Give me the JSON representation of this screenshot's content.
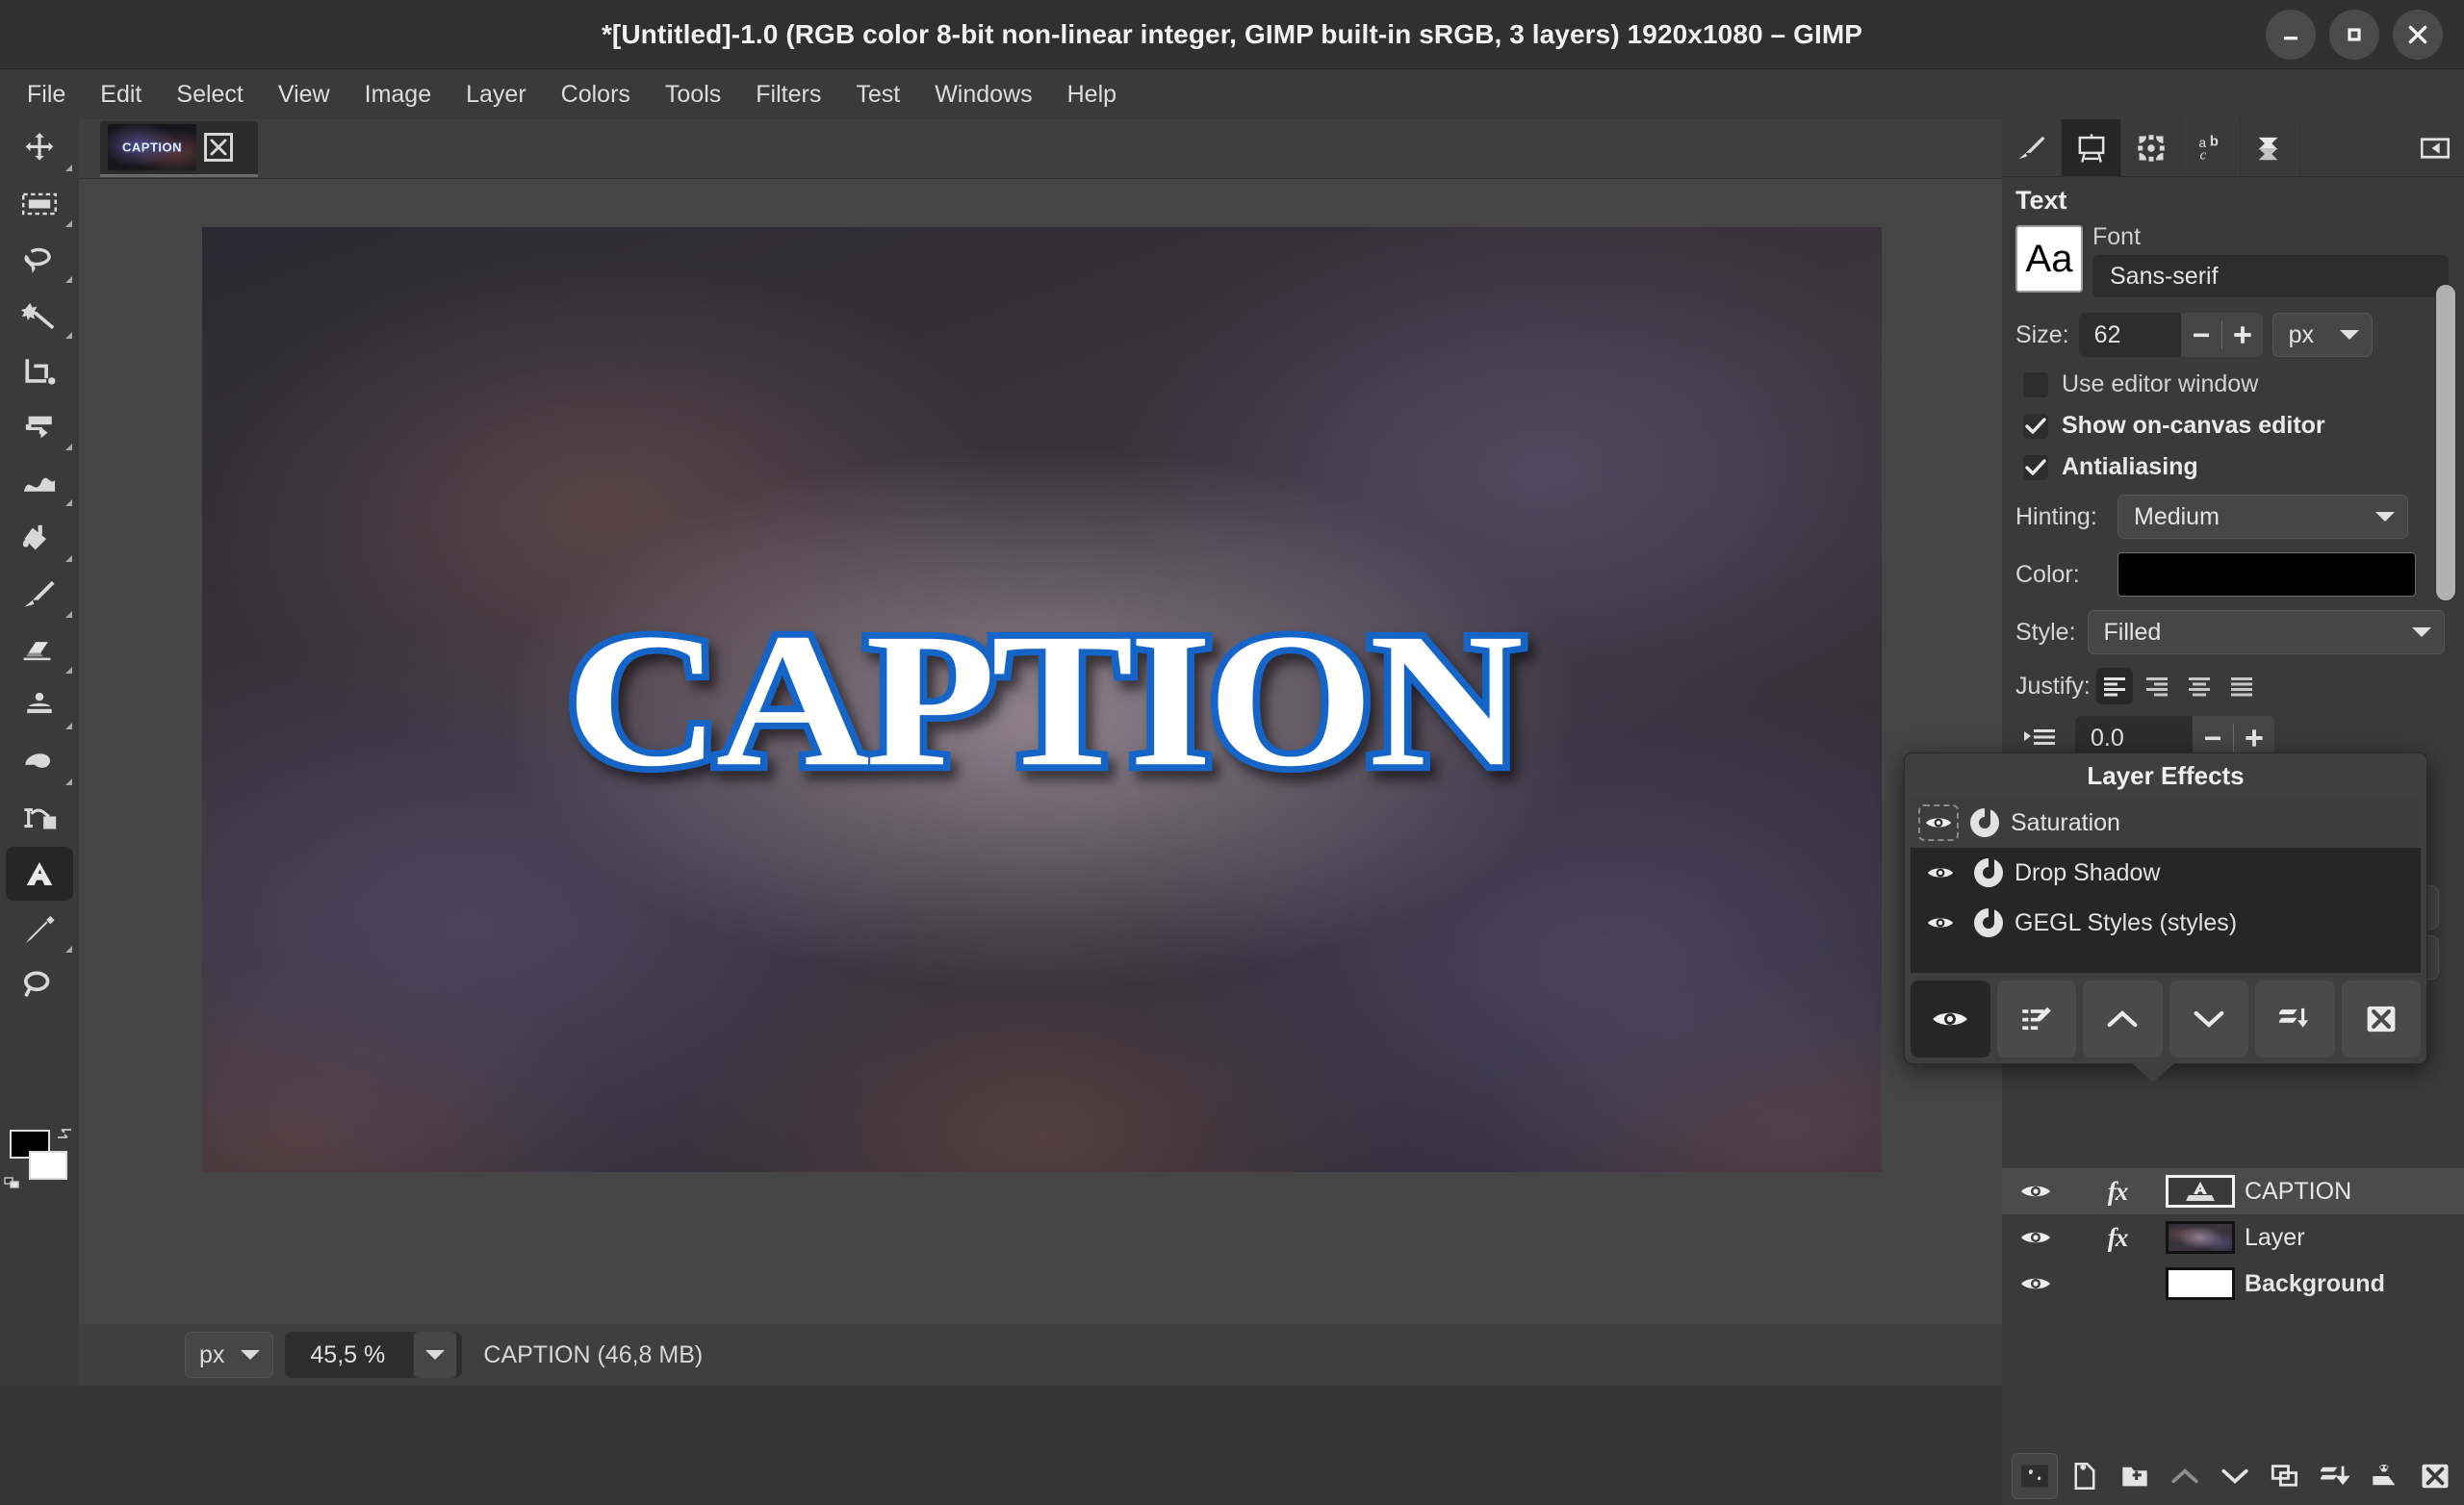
{
  "window": {
    "title": "*[Untitled]-1.0 (RGB color 8-bit non-linear integer, GIMP built-in sRGB, 3 layers) 1920x1080 – GIMP",
    "minimize_label": "minimize",
    "maximize_label": "maximize",
    "close_label": "close"
  },
  "menubar": {
    "items": [
      "File",
      "Edit",
      "Select",
      "View",
      "Image",
      "Layer",
      "Colors",
      "Tools",
      "Filters",
      "Test",
      "Windows",
      "Help"
    ]
  },
  "toolbox": {
    "tools": [
      {
        "name": "move-tool",
        "icon": "move-icon"
      },
      {
        "name": "rectangle-select-tool",
        "icon": "rectangle-select-icon"
      },
      {
        "name": "free-select-tool",
        "icon": "lasso-icon"
      },
      {
        "name": "fuzzy-select-tool",
        "icon": "magic-wand-icon"
      },
      {
        "name": "crop-tool",
        "icon": "crop-icon"
      },
      {
        "name": "transform-tool",
        "icon": "transform-icon"
      },
      {
        "name": "warp-transform-tool",
        "icon": "warp-icon"
      },
      {
        "name": "bucket-fill-tool",
        "icon": "bucket-fill-icon"
      },
      {
        "name": "paintbrush-tool",
        "icon": "paintbrush-icon"
      },
      {
        "name": "eraser-tool",
        "icon": "eraser-icon"
      },
      {
        "name": "clone-tool",
        "icon": "clone-stamp-icon"
      },
      {
        "name": "smudge-tool",
        "icon": "smudge-icon"
      },
      {
        "name": "paths-tool",
        "icon": "paths-icon"
      },
      {
        "name": "text-tool",
        "icon": "text-a-icon"
      },
      {
        "name": "color-picker-tool",
        "icon": "eyedropper-icon"
      },
      {
        "name": "zoom-tool",
        "icon": "magnifier-icon"
      }
    ],
    "active_tool": "text-tool",
    "foreground_color": "#000000",
    "background_color": "#ffffff"
  },
  "tab": {
    "thumbnail_label": "CAPTION",
    "close_label": "close-image"
  },
  "canvas": {
    "caption_text": "CAPTION",
    "text_fill_color": "#ffffff",
    "text_stroke_color": "#1565c8"
  },
  "statusbar": {
    "unit": "px",
    "zoom": "45,5 %",
    "status": "CAPTION (46,8 MB)"
  },
  "dock": {
    "tabs": [
      {
        "name": "tab-brushes",
        "icon": "paintbrush-icon"
      },
      {
        "name": "tab-tool-options",
        "icon": "tool-options-easel-icon"
      },
      {
        "name": "tab-patterns",
        "icon": "patterns-icon"
      },
      {
        "name": "tab-fonts",
        "icon": "fonts-abc-icon"
      },
      {
        "name": "tab-document-history",
        "icon": "layers-stack-icon"
      }
    ],
    "active_tab": "tab-tool-options",
    "collapse_label": "collapse-dock"
  },
  "tool_options": {
    "section_title": "Text",
    "font_preview_glyphs": "Aa",
    "font_label": "Font",
    "font_value": "Sans-serif",
    "size_label": "Size:",
    "size_value": "62",
    "size_unit": "px",
    "checkboxes": [
      {
        "label": "Use editor window",
        "checked": false
      },
      {
        "label": "Show on-canvas editor",
        "checked": true
      },
      {
        "label": "Antialiasing",
        "checked": true
      }
    ],
    "hinting_label": "Hinting:",
    "hinting_value": "Medium",
    "color_label": "Color:",
    "color_value": "#000000",
    "style_label": "Style:",
    "style_value": "Filled",
    "justify_label": "Justify:",
    "justify_options": [
      "justify-left",
      "justify-right",
      "justify-center",
      "justify-fill"
    ],
    "justify_active": "justify-left",
    "indent_value": "0.0"
  },
  "layer_effects": {
    "title": "Layer Effects",
    "effects": [
      {
        "name": "Saturation",
        "visible": true,
        "selected": true
      },
      {
        "name": "Drop Shadow",
        "visible": true,
        "selected": false
      },
      {
        "name": "GEGL Styles (styles)",
        "visible": true,
        "selected": false
      }
    ],
    "buttons": [
      {
        "name": "toggle-effect-visibility-button",
        "icon": "eye-icon",
        "active": true
      },
      {
        "name": "edit-effect-button",
        "icon": "edit-list-icon",
        "active": false
      },
      {
        "name": "raise-effect-button",
        "icon": "chevron-up-icon",
        "active": false
      },
      {
        "name": "lower-effect-button",
        "icon": "chevron-down-icon",
        "active": false
      },
      {
        "name": "merge-effect-button",
        "icon": "merge-down-icon",
        "active": false
      },
      {
        "name": "delete-effect-button",
        "icon": "delete-x-icon",
        "active": false
      }
    ]
  },
  "layers": {
    "rows": [
      {
        "name": "CAPTION",
        "has_fx": true,
        "visible": true,
        "selected": true,
        "thumb": "text-layer"
      },
      {
        "name": "Layer",
        "has_fx": true,
        "visible": true,
        "selected": false,
        "thumb": "gradient"
      },
      {
        "name": "Background",
        "has_fx": false,
        "visible": true,
        "selected": false,
        "thumb": "white"
      }
    ],
    "fx_label": "fx",
    "toolbar": [
      {
        "name": "layer-mode-button",
        "icon": "layer-mask-icon"
      },
      {
        "name": "new-layer-button",
        "icon": "new-page-icon"
      },
      {
        "name": "new-layer-group-button",
        "icon": "new-folder-icon"
      },
      {
        "name": "raise-layer-button",
        "icon": "chevron-up-icon"
      },
      {
        "name": "lower-layer-button",
        "icon": "chevron-down-icon"
      },
      {
        "name": "duplicate-layer-button",
        "icon": "duplicate-icon"
      },
      {
        "name": "merge-down-button",
        "icon": "merge-down-icon"
      },
      {
        "name": "anchor-layer-button",
        "icon": "anchor-mask-icon"
      },
      {
        "name": "delete-layer-button",
        "icon": "delete-x-icon"
      }
    ]
  },
  "scrollbar": {
    "name": "tool-options-scrollbar"
  }
}
